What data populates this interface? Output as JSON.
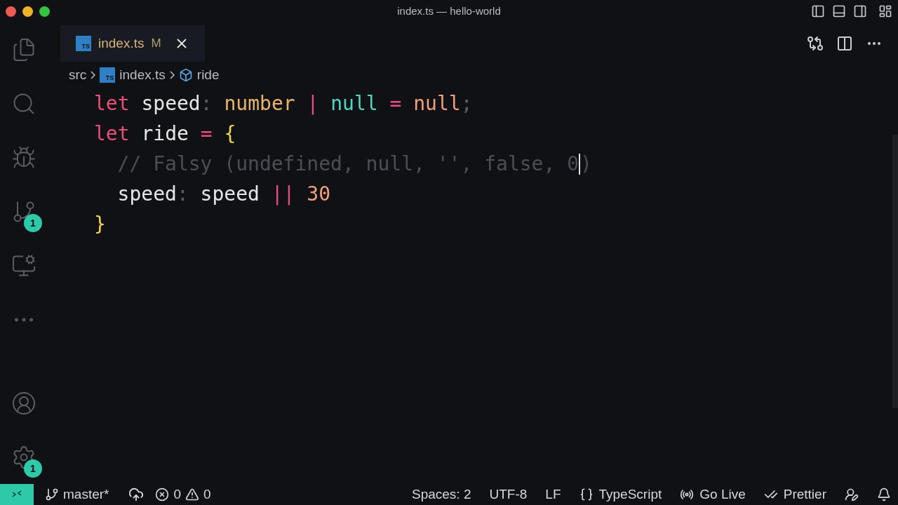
{
  "window": {
    "title": "index.ts — hello-world"
  },
  "activity_bar": {
    "source_control_badge": "1",
    "settings_badge": "1"
  },
  "tabs": [
    {
      "icon_text": "TS",
      "label": "index.ts",
      "status": "M",
      "selected": true
    }
  ],
  "breadcrumbs": [
    {
      "label": "src"
    },
    {
      "icon_text": "TS",
      "label": "index.ts"
    },
    {
      "label": "ride"
    }
  ],
  "code_lines": [
    {
      "tokens": [
        {
          "kind": "keyword",
          "text": "let"
        },
        {
          "kind": "plain",
          "text": " speed"
        },
        {
          "kind": "punct",
          "text": ":"
        },
        {
          "kind": "type",
          "text": " number"
        },
        {
          "kind": "op",
          "text": " |"
        },
        {
          "kind": "literal",
          "text": " null"
        },
        {
          "kind": "op",
          "text": " ="
        },
        {
          "kind": "value",
          "text": " null"
        },
        {
          "kind": "punct",
          "text": ";"
        }
      ]
    },
    {
      "tokens": [
        {
          "kind": "keyword",
          "text": "let"
        },
        {
          "kind": "plain",
          "text": " ride"
        },
        {
          "kind": "op",
          "text": " ="
        },
        {
          "kind": "brace",
          "text": " {"
        }
      ],
      "children": [
        {
          "tokens": [
            {
              "kind": "comment",
              "text": "// Falsy (undefined, null, '', false, 0"
            },
            {
              "kind": "cursor"
            },
            {
              "kind": "comment",
              "text": ")"
            }
          ]
        },
        {
          "tokens": [
            {
              "kind": "plain",
              "text": "speed"
            },
            {
              "kind": "punct",
              "text": ":"
            },
            {
              "kind": "plain",
              "text": " speed"
            },
            {
              "kind": "op",
              "text": " ||"
            },
            {
              "kind": "number",
              "text": " 30"
            }
          ]
        }
      ]
    },
    {
      "tokens": [
        {
          "kind": "brace",
          "text": "}"
        }
      ]
    }
  ],
  "status_bar": {
    "branch": "master*",
    "errors": "0",
    "warnings": "0",
    "right": [
      "Spaces: 2",
      "UTF-8",
      "LF",
      "TypeScript",
      "Go Live",
      "Prettier"
    ]
  }
}
